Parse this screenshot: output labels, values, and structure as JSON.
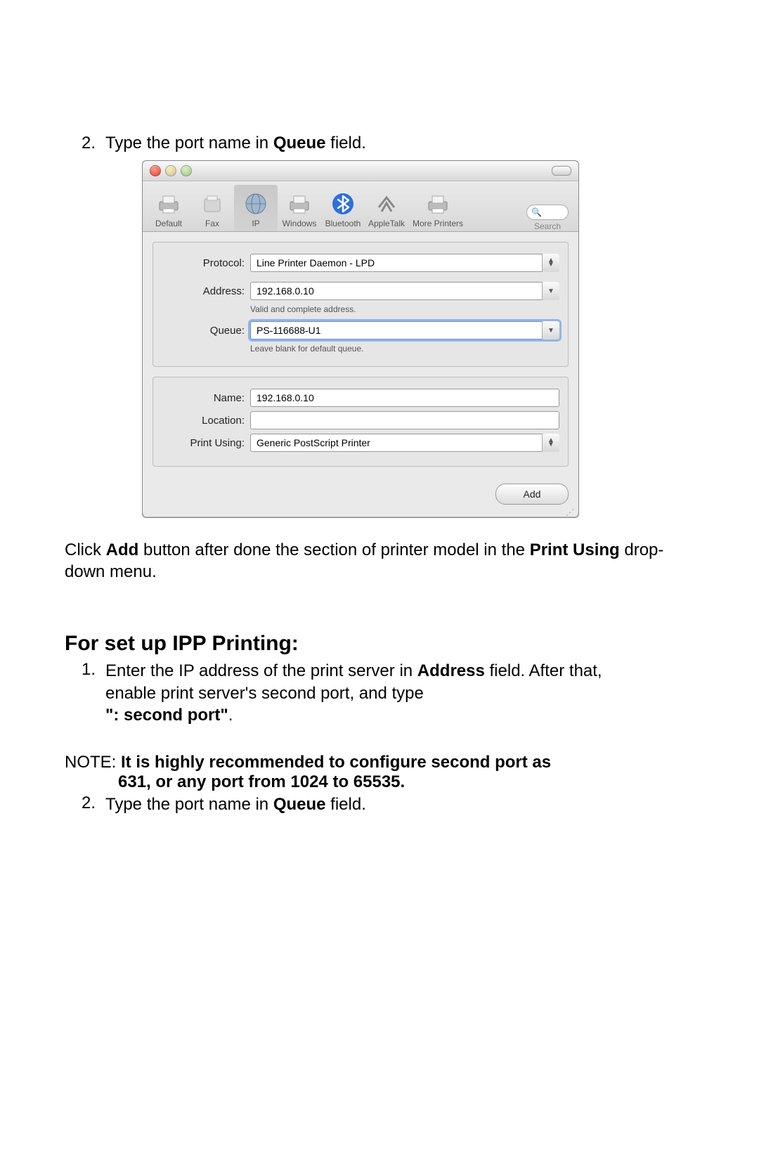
{
  "step2": {
    "num": "2.",
    "pre": "Type the port name in ",
    "bold": "Queue",
    "post": " field."
  },
  "toolbar": {
    "items": [
      {
        "label": "Default",
        "icon": "printer"
      },
      {
        "label": "Fax",
        "icon": "fax"
      },
      {
        "label": "IP",
        "icon": "globe"
      },
      {
        "label": "Windows",
        "icon": "printer"
      },
      {
        "label": "Bluetooth",
        "icon": "bluetooth"
      },
      {
        "label": "AppleTalk",
        "icon": "appletalk"
      },
      {
        "label": "More Printers",
        "icon": "printer"
      }
    ],
    "search_label": "Search"
  },
  "form": {
    "protocol_label": "Protocol:",
    "protocol_value": "Line Printer Daemon - LPD",
    "address_label": "Address:",
    "address_value": "192.168.0.10",
    "address_hint": "Valid and complete address.",
    "queue_label": "Queue:",
    "queue_value": "PS-116688-U1",
    "queue_hint": "Leave blank for default queue.",
    "name_label": "Name:",
    "name_value": "192.168.0.10",
    "location_label": "Location:",
    "location_value": "",
    "printusing_label": "Print Using:",
    "printusing_value": "Generic PostScript Printer",
    "add_button": "Add"
  },
  "after_ss": {
    "p1_a": "Click ",
    "p1_b": "Add",
    "p1_c": " button after done the section of printer model in the ",
    "p1_d": "Print Using",
    "p1_e": " drop-down menu."
  },
  "ipp": {
    "heading": "For set up IPP Printing:",
    "i1_num": "1.",
    "i1_a": "Enter the IP address of the print server in ",
    "i1_b": "Address",
    "i1_c": " field. After that, enable print server's second port, and type",
    "i1_quote": "\": second port\"",
    "i1_dot": ".",
    "note_pre": "NOTE: ",
    "note_b1": "It is highly recommended to configure second port as 631, or any port from 1024 to 65535.",
    "i2_num": "2.",
    "i2_a": "Type the port name in ",
    "i2_b": "Queue",
    "i2_c": " field."
  }
}
